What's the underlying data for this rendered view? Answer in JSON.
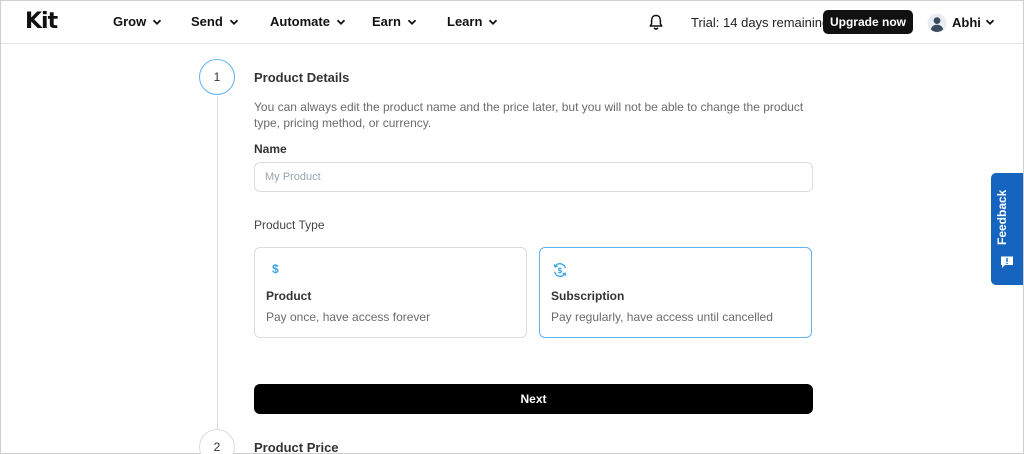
{
  "nav": {
    "logo": "Kit",
    "items": [
      {
        "label": "Grow"
      },
      {
        "label": "Send"
      },
      {
        "label": "Automate"
      },
      {
        "label": "Earn"
      },
      {
        "label": "Learn"
      }
    ],
    "notifications_icon": "bell-icon",
    "trial_text": "Trial: 14 days remaining",
    "upgrade_label": "Upgrade now",
    "user": {
      "name": "Abhi",
      "avatar_icon": "user-avatar-icon"
    }
  },
  "steps": [
    {
      "number": "1",
      "title": "Product Details"
    },
    {
      "number": "2",
      "title": "Product Price"
    }
  ],
  "form": {
    "description": "You can always edit the product name and the price later, but you will not be able to change the product type, pricing method, or currency.",
    "name_label": "Name",
    "name_placeholder": "My Product",
    "name_value": "",
    "type_label": "Product Type",
    "types": [
      {
        "icon": "dollar-icon",
        "icon_glyph": "$",
        "title": "Product",
        "subtitle": "Pay once, have access forever",
        "selected": false
      },
      {
        "icon": "refresh-dollar-icon",
        "title": "Subscription",
        "subtitle": "Pay regularly, have access until cancelled",
        "selected": true
      }
    ],
    "next_label": "Next"
  },
  "feedback": {
    "label": "Feedback",
    "icon": "chat-icon"
  },
  "colors": {
    "accent": "#5fb3f0",
    "feedback_bg": "#1565c0",
    "primary_button": "#000000"
  }
}
